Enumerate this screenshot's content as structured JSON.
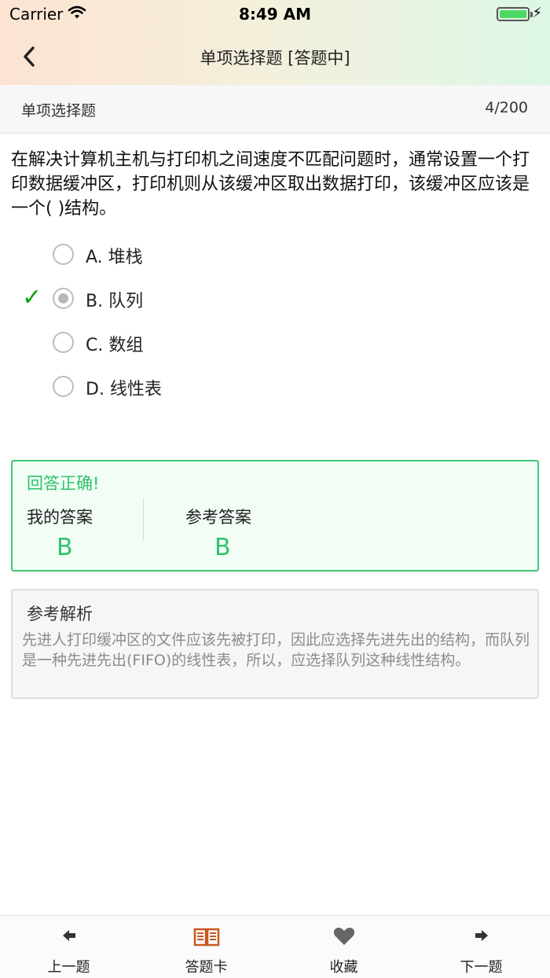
{
  "status_bar": {
    "carrier": "Carrier",
    "time": "8:49 AM",
    "battery_color": "#4cd964"
  },
  "nav": {
    "title": "单项选择题 [答题中]",
    "back_icon": "chevron-left-icon"
  },
  "subheader": {
    "category": "单项选择题",
    "progress": "4/200"
  },
  "question": {
    "text": "在解决计算机主机与打印机之间速度不匹配问题时，通常设置一个打印数据缓冲区，打印机则从该缓冲区取出数据打印，该缓冲区应该是一个(   )结构。"
  },
  "options": [
    {
      "label": "A. 堆栈",
      "selected": false,
      "correct": false
    },
    {
      "label": "B. 队列",
      "selected": true,
      "correct": true,
      "check": "✓"
    },
    {
      "label": "C. 数组",
      "selected": false,
      "correct": false
    },
    {
      "label": "D. 线性表",
      "selected": false,
      "correct": false
    }
  ],
  "result": {
    "status": "回答正确!",
    "my_answer_label": "我的答案",
    "my_answer": "B",
    "ref_answer_label": "参考答案",
    "ref_answer": "B",
    "accent_color": "#2ec36c"
  },
  "analysis": {
    "title": "参考解析",
    "body": "先进人打印缓冲区的文件应该先被打印，因此应选择先进先出的结构，而队列是一种先进先出(FIFO)的线性表，所以，应选择队列这种线性结构。"
  },
  "tabbar": [
    {
      "label": "上一题",
      "icon": "arrow-left-icon"
    },
    {
      "label": "答题卡",
      "icon": "book-icon",
      "color": "#c8581e"
    },
    {
      "label": "收藏",
      "icon": "heart-icon"
    },
    {
      "label": "下一题",
      "icon": "arrow-right-icon"
    }
  ]
}
